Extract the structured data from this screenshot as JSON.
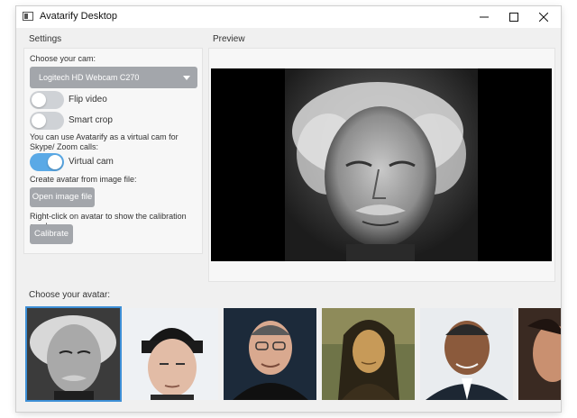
{
  "window": {
    "title": "Avatarify Desktop",
    "controls": [
      "minimize-icon",
      "maximize-icon",
      "close-icon"
    ]
  },
  "settings": {
    "header": "Settings",
    "cam_label": "Choose your cam:",
    "cam_selected": "Logitech HD Webcam C270",
    "flip_video": {
      "label": "Flip video",
      "on": false
    },
    "smart_crop": {
      "label": "Smart crop",
      "on": false
    },
    "virtual_cam_hint": "You can use Avatarify as a virtual cam for Skype/ Zoom calls:",
    "virtual_cam": {
      "label": "Virtual cam",
      "on": true
    },
    "image_file_hint": "Create avatar from image file:",
    "open_image_button": "Open image file",
    "calibration_hint": "Right-click on avatar to show the calibration overlay:",
    "calibrate_button": "Calibrate"
  },
  "preview": {
    "header": "Preview"
  },
  "avatars": {
    "header": "Choose your avatar:",
    "selected_index": 0,
    "items": [
      "avatar-einstein",
      "avatar-eminem",
      "avatar-jobs",
      "avatar-mona-lisa",
      "avatar-obama",
      "avatar-partial"
    ]
  },
  "colors": {
    "accent": "#5aa9e6",
    "selection": "#3d8fd6",
    "button": "#a3a6ab",
    "toggle_off": "#cfd2d6"
  }
}
